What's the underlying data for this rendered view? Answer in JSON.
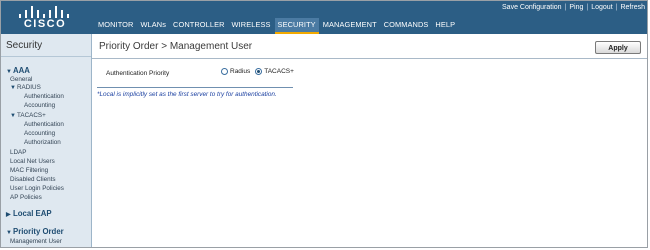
{
  "header": {
    "logo_text": "CISCO",
    "links": [
      "Save Configuration",
      "Ping",
      "Logout",
      "Refresh"
    ],
    "menu": [
      "MONITOR",
      "WLANs",
      "CONTROLLER",
      "WIRELESS",
      "SECURITY",
      "MANAGEMENT",
      "COMMANDS",
      "HELP"
    ],
    "active_menu": "SECURITY"
  },
  "sidebar": {
    "title": "Security",
    "aaa": "AAA",
    "general": "General",
    "radius": "RADIUS",
    "radius_auth": "Authentication",
    "radius_acct": "Accounting",
    "tacacs": "TACACS+",
    "tacacs_auth": "Authentication",
    "tacacs_acct": "Accounting",
    "tacacs_authz": "Authorization",
    "ldap": "LDAP",
    "local_net_users": "Local Net Users",
    "mac_filtering": "MAC Filtering",
    "disabled_clients": "Disabled Clients",
    "user_login_policies": "User Login Policies",
    "ap_policies": "AP Policies",
    "local_eap": "Local EAP",
    "priority_order": "Priority Order",
    "management_user": "Management User"
  },
  "main": {
    "title": "Priority Order > Management User",
    "apply_label": "Apply",
    "field_label": "Authentication Priority",
    "options": [
      {
        "label": "Radius",
        "selected": false
      },
      {
        "label": "TACACS+",
        "selected": true
      }
    ],
    "note": "*Local is implicitly set as the first server to try for authentication."
  },
  "colors": {
    "header_bg": "#2c5e85",
    "active_tab_underline": "#f2a900",
    "sidebar_bg": "#dfe8f0",
    "note_text": "#1a3fa0"
  }
}
